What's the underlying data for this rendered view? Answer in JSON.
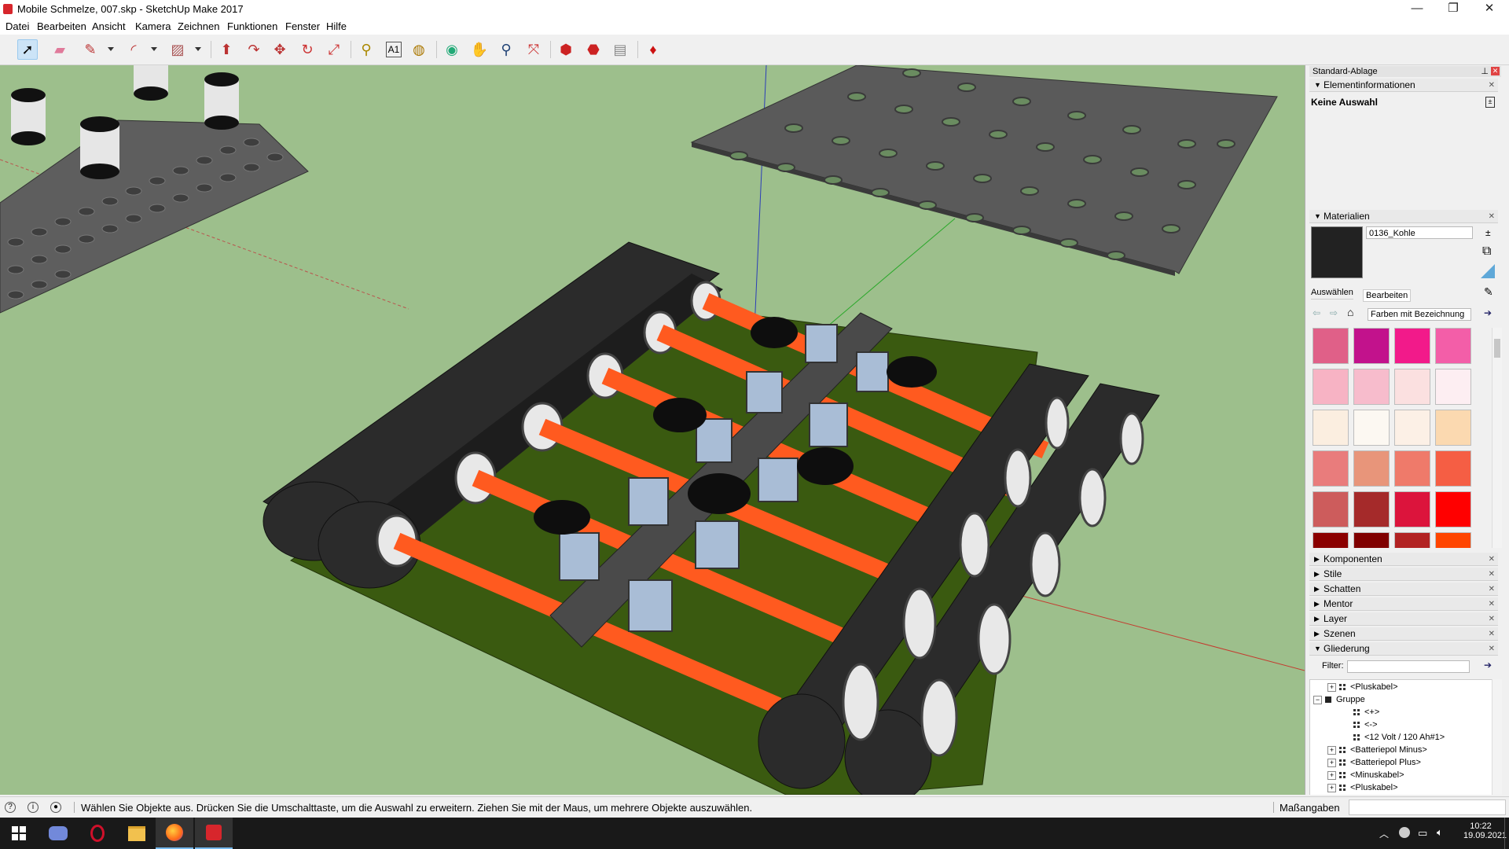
{
  "window": {
    "title": "Mobile Schmelze, 007.skp - SketchUp Make 2017",
    "minimize": "—",
    "restore": "❐",
    "close": "✕"
  },
  "menu": [
    "Datei",
    "Bearbeiten",
    "Ansicht",
    "Kamera",
    "Zeichnen",
    "Funktionen",
    "Fenster",
    "Hilfe"
  ],
  "toolbar": {
    "tools": [
      "select-icon",
      "eraser-icon",
      "line-icon",
      "arc-icon",
      "shape-icon",
      "push-pull-icon",
      "follow-me-icon",
      "move-icon",
      "rotate-icon",
      "scale-icon",
      "tape-measure-icon",
      "text-icon",
      "paint-bucket-icon",
      "orbit-icon",
      "pan-icon",
      "zoom-icon",
      "zoom-extents-icon",
      "warehouse-icon",
      "extension-icon",
      "layout-icon",
      "ruby-icon"
    ]
  },
  "tray": {
    "title": "Standard-Ablage",
    "entity_info": {
      "header": "Elementinformationen",
      "selection": "Keine Auswahl"
    },
    "materials": {
      "header": "Materialien",
      "name": "0136_Kohle",
      "current_color": "#222222",
      "tab_select": "Auswählen",
      "tab_edit": "Bearbeiten",
      "library": "Farben mit Bezeichnung",
      "swatches": [
        "#e06088",
        "#c2128c",
        "#f21a8a",
        "#f35ea8",
        "#f7b3c4",
        "#f7bccc",
        "#fbe0e0",
        "#fdeef2",
        "#fbeee0",
        "#fcf8f2",
        "#fcf0e6",
        "#fbd9b0",
        "#e97c7c",
        "#e8957a",
        "#ef7a6a",
        "#f55e44",
        "#cd5c5c",
        "#a52a2a",
        "#dc143c",
        "#ff0000",
        "#8b0000",
        "#800000",
        "#b22222",
        "#ff4500"
      ]
    },
    "collapsed_sections": [
      "Komponenten",
      "Stile",
      "Schatten",
      "Mentor",
      "Layer",
      "Szenen"
    ],
    "outliner": {
      "header": "Gliederung",
      "filter_label": "Filter:",
      "filter_value": "",
      "rows": [
        {
          "label": "<Pluskabel>",
          "indent": 1,
          "type": "component",
          "expand": "+"
        },
        {
          "label": "Gruppe",
          "indent": 0,
          "type": "group",
          "expand": "−"
        },
        {
          "label": "<+>",
          "indent": 2,
          "type": "component",
          "expand": ""
        },
        {
          "label": "<->",
          "indent": 2,
          "type": "component",
          "expand": ""
        },
        {
          "label": "<12 Volt / 120 Ah#1>",
          "indent": 2,
          "type": "component",
          "expand": ""
        },
        {
          "label": "<Batteriepol Minus>",
          "indent": 1,
          "type": "component",
          "expand": "+"
        },
        {
          "label": "<Batteriepol Plus>",
          "indent": 1,
          "type": "component",
          "expand": "+"
        },
        {
          "label": "<Minuskabel>",
          "indent": 1,
          "type": "component",
          "expand": "+"
        },
        {
          "label": "<Pluskabel>",
          "indent": 1,
          "type": "component",
          "expand": "+"
        }
      ]
    }
  },
  "status": {
    "message": "Wählen Sie Objekte aus. Drücken Sie die Umschalttaste, um die Auswahl zu erweitern. Ziehen Sie mit der Maus, um mehrere Objekte auszuwählen.",
    "measurements_label": "Maßangaben",
    "measurements_value": ""
  },
  "taskbar": {
    "apps": [
      "windows-start-icon",
      "discord-icon",
      "opera-icon",
      "file-explorer-icon",
      "firefox-icon",
      "sketchup-icon"
    ],
    "active_apps": [
      "firefox-icon",
      "sketchup-icon"
    ],
    "time": "10:22",
    "date": "19.09.2021"
  },
  "colors": {
    "viewport_ground": "#9dbf8c",
    "track": "#2b2b2b",
    "axle": "#ff5a1f",
    "platform": "#3a5a10",
    "battery": "#a9bdd6"
  }
}
